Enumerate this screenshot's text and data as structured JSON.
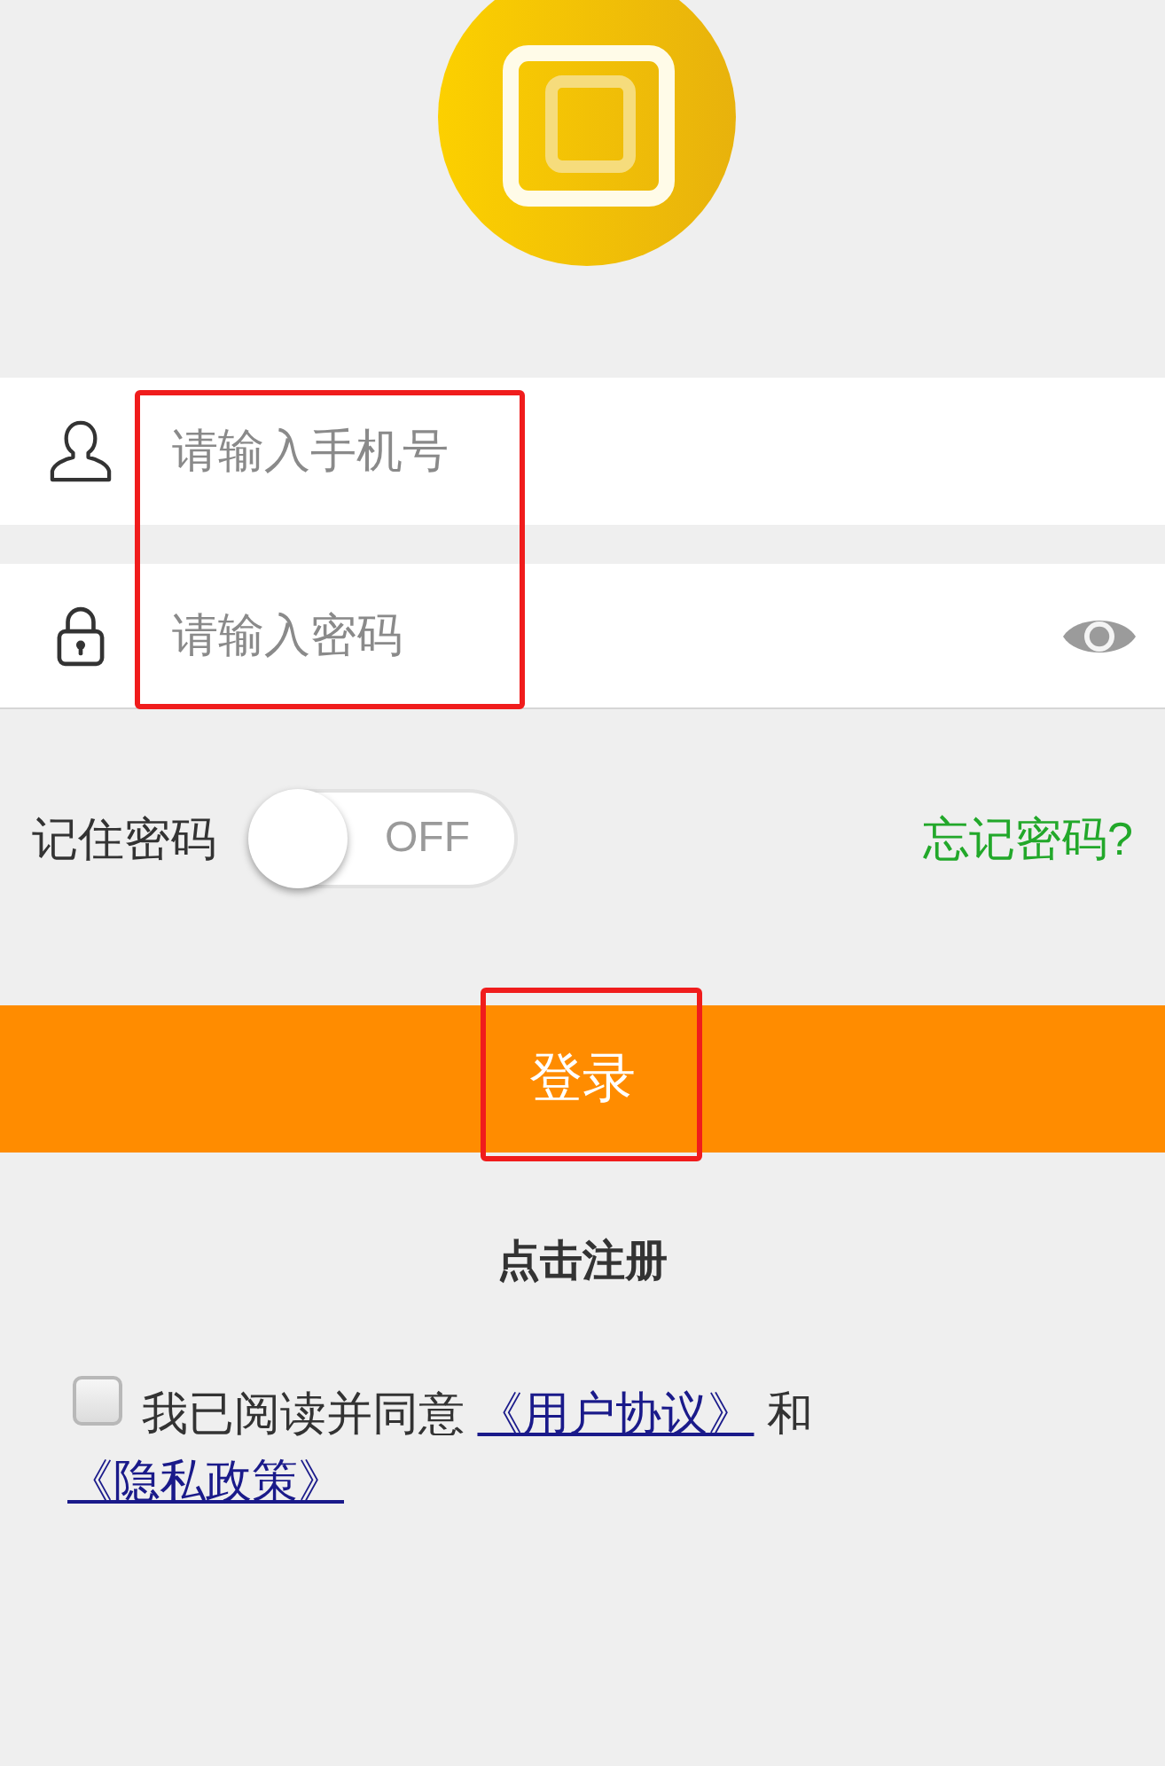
{
  "credentials": {
    "highlighted": true,
    "fields": [
      {
        "kind": "phone",
        "placeholder": "请输入手机号"
      },
      {
        "kind": "password",
        "placeholder": "请输入密码"
      }
    ]
  },
  "remember": {
    "label": "记住密码",
    "on": false,
    "switch_text": "OFF"
  },
  "forgot_password": "忘记密码?",
  "login_button": {
    "label": "登录",
    "highlighted": true
  },
  "register_link": "点击注册",
  "agreement": {
    "checked": false,
    "parts": [
      {
        "kind": "text",
        "text": "我已阅读并同意"
      },
      {
        "kind": "link",
        "text": "《用户协议》"
      },
      {
        "kind": "text",
        "text": "和"
      },
      {
        "kind": "link",
        "text": "《隐私政策》"
      }
    ]
  }
}
